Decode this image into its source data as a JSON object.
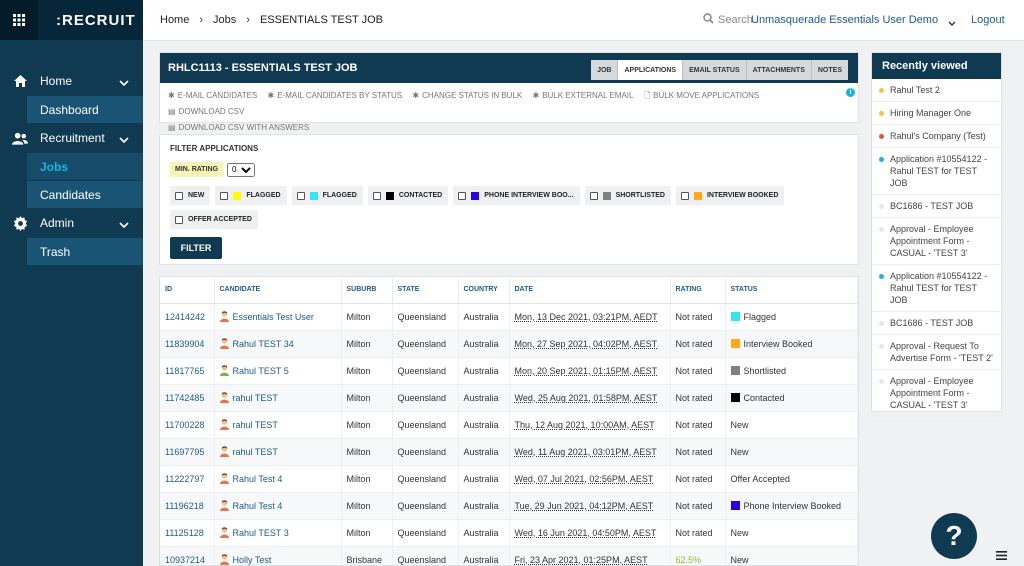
{
  "app": {
    "name": ":RECRUIT"
  },
  "sidebar": {
    "groups": [
      {
        "label": "Home",
        "icon": "home-icon",
        "subs": [
          {
            "label": "Dashboard",
            "active": false
          }
        ]
      },
      {
        "label": "Recruitment",
        "icon": "users-icon",
        "subs": [
          {
            "label": "Jobs",
            "active": true
          },
          {
            "label": "Candidates",
            "active": false
          }
        ]
      },
      {
        "label": "Admin",
        "icon": "gear-icon",
        "subs": [
          {
            "label": "Trash",
            "active": false
          }
        ]
      }
    ]
  },
  "topbar": {
    "breadcrumb": [
      "Home",
      "Jobs",
      "ESSENTIALS TEST JOB"
    ],
    "search_placeholder": "Search...",
    "user": "Unmasquerade Essentials User Demo",
    "logout": "Logout"
  },
  "job": {
    "title": "RHLC1113 - ESSENTIALS TEST JOB",
    "tabs": [
      {
        "label": "JOB",
        "active": false
      },
      {
        "label": "APPLICATIONS",
        "active": true
      },
      {
        "label": "EMAIL STATUS",
        "active": false
      },
      {
        "label": "ATTACHMENTS",
        "active": false
      },
      {
        "label": "NOTES",
        "active": false
      }
    ],
    "actions": [
      "E-MAIL CANDIDATES",
      "E-MAIL CANDIDATES BY STATUS",
      "CHANGE STATUS IN BULK",
      "BULK EXTERNAL EMAIL",
      "BULK MOVE APPLICATIONS",
      "DOWNLOAD CSV",
      "DOWNLOAD CSV WITH ANSWERS"
    ]
  },
  "filter": {
    "title": "FILTER APPLICATIONS",
    "min_rating_label": "MIN. RATING",
    "min_rating_value": "0",
    "statuses": [
      {
        "label": "NEW",
        "color": ""
      },
      {
        "label": "FLAGGED",
        "color": "#ffff00"
      },
      {
        "label": "FLAGGED",
        "color": "#33e6f0"
      },
      {
        "label": "CONTACTED",
        "color": "#000000"
      },
      {
        "label": "PHONE INTERVIEW BOO...",
        "color": "#2a00e6"
      },
      {
        "label": "SHORTLISTED",
        "color": "#808080"
      },
      {
        "label": "INTERVIEW BOOKED",
        "color": "#ffa81a"
      },
      {
        "label": "OFFER ACCEPTED",
        "color": ""
      }
    ],
    "button": "FILTER"
  },
  "table": {
    "headers": [
      "ID",
      "CANDIDATE",
      "SUBURB",
      "STATE",
      "COUNTRY",
      "DATE",
      "RATING",
      "STATUS"
    ],
    "rows": [
      {
        "id": "12414242",
        "candidate": "Essentials Test User",
        "avatar": "red",
        "suburb": "Milton",
        "state": "Queensland",
        "country": "Australia",
        "date": "Mon, 13 Dec 2021, 03:21PM, AEDT",
        "rating": "Not rated",
        "status": "Flagged",
        "status_color": "#33e6f0"
      },
      {
        "id": "11839904",
        "candidate": "Rahul TEST 34",
        "avatar": "red",
        "suburb": "Milton",
        "state": "Queensland",
        "country": "Australia",
        "date": "Mon, 27 Sep 2021, 04:02PM, AEST",
        "rating": "Not rated",
        "status": "Interview Booked",
        "status_color": "#ffa81a"
      },
      {
        "id": "11817765",
        "candidate": "Rahul TEST 5",
        "avatar": "green",
        "suburb": "Milton",
        "state": "Queensland",
        "country": "Australia",
        "date": "Mon, 20 Sep 2021, 01:15PM, AEST",
        "rating": "Not rated",
        "status": "Shortlisted",
        "status_color": "#808080"
      },
      {
        "id": "11742485",
        "candidate": "rahul TEST",
        "avatar": "red",
        "suburb": "Milton",
        "state": "Queensland",
        "country": "Australia",
        "date": "Wed, 25 Aug 2021, 01:58PM, AEST",
        "rating": "Not rated",
        "status": "Contacted",
        "status_color": "#000000"
      },
      {
        "id": "11700228",
        "candidate": "rahul TEST",
        "avatar": "red",
        "suburb": "Milton",
        "state": "Queensland",
        "country": "Australia",
        "date": "Thu, 12 Aug 2021, 10:00AM, AEST",
        "rating": "Not rated",
        "status": "New",
        "status_color": ""
      },
      {
        "id": "11697795",
        "candidate": "rahul TEST",
        "avatar": "red",
        "suburb": "Milton",
        "state": "Queensland",
        "country": "Australia",
        "date": "Wed, 11 Aug 2021, 03:01PM, AEST",
        "rating": "Not rated",
        "status": "New",
        "status_color": ""
      },
      {
        "id": "11222797",
        "candidate": "Rahul Test 4",
        "avatar": "red",
        "suburb": "Milton",
        "state": "Queensland",
        "country": "Australia",
        "date": "Wed, 07 Jul 2021, 02:56PM, AEST",
        "rating": "Not rated",
        "status": "Offer Accepted",
        "status_color": ""
      },
      {
        "id": "11196218",
        "candidate": "Rahul Test 4",
        "avatar": "red",
        "suburb": "Milton",
        "state": "Queensland",
        "country": "Australia",
        "date": "Tue, 29 Jun 2021, 04:12PM, AEST",
        "rating": "Not rated",
        "status": "Phone Interview Booked",
        "status_color": "#2a00e6"
      },
      {
        "id": "11125128",
        "candidate": "Rahul TEST 3",
        "avatar": "red",
        "suburb": "Milton",
        "state": "Queensland",
        "country": "Australia",
        "date": "Wed, 16 Jun 2021, 04:50PM, AEST",
        "rating": "Not rated",
        "status": "New",
        "status_color": ""
      },
      {
        "id": "10937214",
        "candidate": "Holly Test",
        "avatar": "red",
        "suburb": "Brisbane",
        "state": "Queensland",
        "country": "Australia",
        "date": "Fri, 23 Apr 2021, 01:25PM, AEST",
        "rating": "62.5%",
        "status": "New",
        "status_color": ""
      }
    ]
  },
  "recent": {
    "title": "Recently viewed",
    "items": [
      {
        "label": "Rahul Test 2",
        "dot": "#f2c14e"
      },
      {
        "label": "Hiring Manager One",
        "dot": "#f2c14e"
      },
      {
        "label": "Rahul's Company (Test)",
        "dot": "#e5533d"
      },
      {
        "label": "Application #10554122 - Rahul TEST for TEST JOB",
        "dot": "#19b4e3"
      },
      {
        "label": "BC1686 - TEST JOB",
        "dot": ""
      },
      {
        "label": "Approval - Employee Appointment Form - CASUAL - 'TEST 3'",
        "dot": ""
      },
      {
        "label": "Application #10554122 - Rahul TEST for TEST JOB",
        "dot": "#19b4e3"
      },
      {
        "label": "BC1686 - TEST JOB",
        "dot": ""
      },
      {
        "label": "Approval - Request To Advertise Form - 'TEST 2'",
        "dot": ""
      },
      {
        "label": "Approval - Employee Appointment Form - CASUAL - 'TEST 3'",
        "dot": ""
      }
    ]
  },
  "help_label": "?"
}
